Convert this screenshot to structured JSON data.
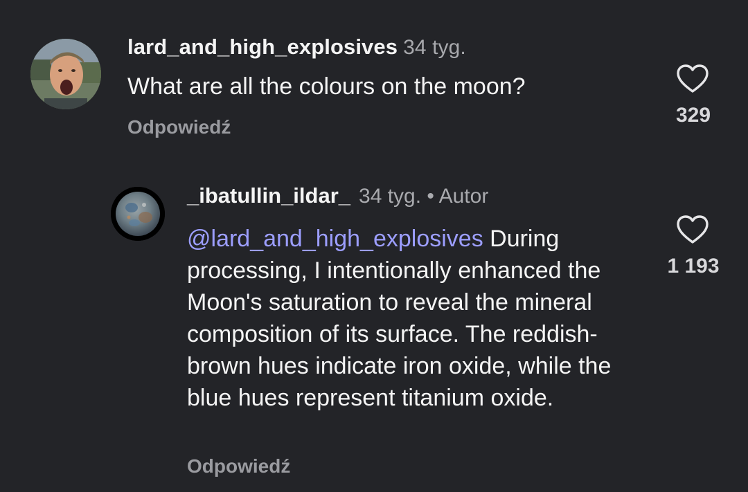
{
  "comments": [
    {
      "username": "lard_and_high_explosives",
      "time": "34 tyg.",
      "text": "What are all the colours on the moon?",
      "reply_label": "Odpowiedź",
      "likes": "329",
      "like_icon": "heart-outline-icon"
    },
    {
      "username": "_ibatullin_ildar_",
      "time": "34 tyg.",
      "separator": " • ",
      "author_badge": "Autor",
      "mention": "@lard_and_high_explosives",
      "text": " During processing, I intentionally enhanced the Moon's saturation to reveal the mineral composition of its surface. The reddish-brown hues indicate iron oxide, while the blue hues represent titanium oxide.",
      "reply_label": "Odpowiedź",
      "likes": "1 193",
      "like_icon": "heart-outline-icon"
    }
  ],
  "colors": {
    "background": "#232428",
    "mention": "#9c9eff",
    "secondary_text": "#a9aaae"
  }
}
